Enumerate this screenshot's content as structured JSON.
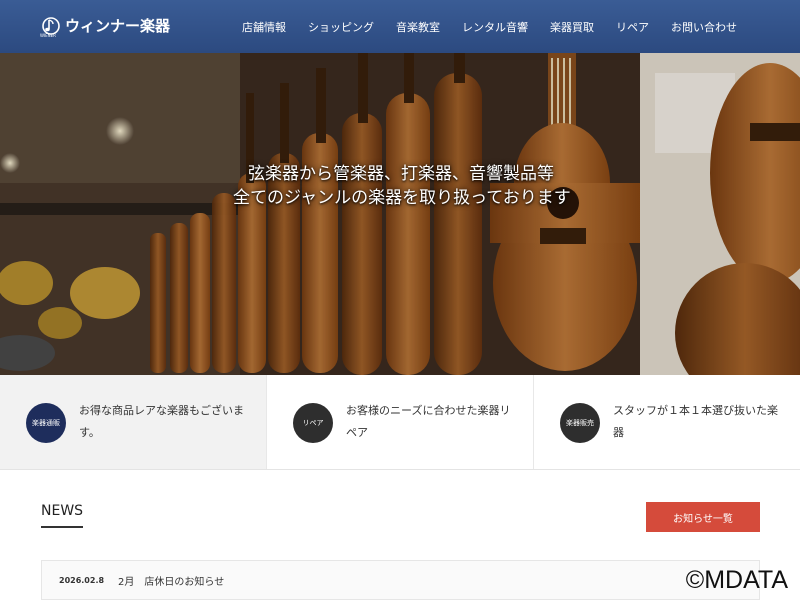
{
  "header": {
    "logo_text": "ウィンナー楽器",
    "logo_sub": "WIENER",
    "nav": [
      {
        "label": "店舗情報"
      },
      {
        "label": "ショッピング"
      },
      {
        "label": "音楽教室"
      },
      {
        "label": "レンタル音響"
      },
      {
        "label": "楽器買取"
      },
      {
        "label": "リペア"
      },
      {
        "label": "お問い合わせ"
      }
    ]
  },
  "hero": {
    "line1": "弦楽器から管楽器、打楽器、音響製品等",
    "line2": "全てのジャンルの楽器を取り扱っております"
  },
  "features": [
    {
      "badge": "楽器通販",
      "text1": "お得な商品レアな楽器もございま",
      "text2": "す。",
      "badge_color": "#1e2d5c"
    },
    {
      "badge": "リペア",
      "text1": "お客様のニーズに合わせた楽器リ",
      "text2": "ペア",
      "badge_color": "#2e2e2e"
    },
    {
      "badge": "楽器販売",
      "text1": "スタッフが１本１本選び抜いた楽",
      "text2": "器",
      "badge_color": "#2e2e2e"
    }
  ],
  "news": {
    "heading": "NEWS",
    "button": "お知らせ一覧",
    "items": [
      {
        "date": "2026.02.8",
        "title": "2月　店休日のお知らせ"
      }
    ]
  },
  "watermark": "©MDATA",
  "colors": {
    "header": "#2f4f86",
    "accent_button": "#d54b3b",
    "badge_navy": "#1e2d5c",
    "badge_dark": "#2e2e2e"
  }
}
